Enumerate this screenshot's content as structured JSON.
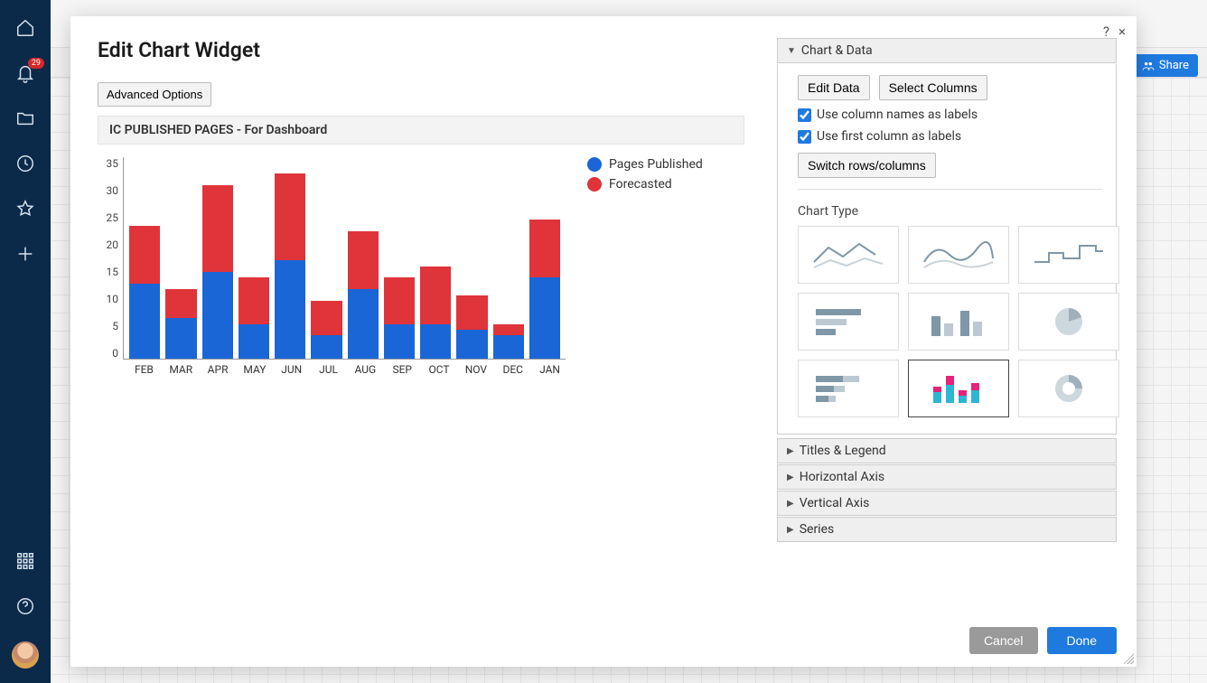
{
  "nav": {
    "notification_count": "29"
  },
  "header": {
    "share_label": "Share"
  },
  "modal": {
    "title": "Edit Chart Widget",
    "advanced_button": "Advanced Options",
    "chart_title": "IC PUBLISHED PAGES - For Dashboard",
    "help_tooltip": "?",
    "close_tooltip": "×"
  },
  "legend": {
    "series1": "Pages Published",
    "series2": "Forecasted"
  },
  "panel": {
    "section_chart_data": "Chart & Data",
    "edit_data": "Edit Data",
    "select_columns": "Select Columns",
    "chk_col_names": "Use column names as labels",
    "chk_first_col": "Use first column as labels",
    "switch_btn": "Switch rows/columns",
    "chart_type_label": "Chart Type",
    "section_titles": "Titles & Legend",
    "section_haxis": "Horizontal Axis",
    "section_vaxis": "Vertical Axis",
    "section_series": "Series",
    "cancel": "Cancel",
    "done": "Done"
  },
  "chart_data": {
    "type": "bar",
    "stacked": true,
    "title": "IC PUBLISHED PAGES - For Dashboard",
    "xlabel": "",
    "ylabel": "",
    "ylim": [
      0,
      35
    ],
    "yticks": [
      0,
      5,
      10,
      15,
      20,
      25,
      30,
      35
    ],
    "categories": [
      "FEB",
      "MAR",
      "APR",
      "MAY",
      "JUN",
      "JUL",
      "AUG",
      "SEP",
      "OCT",
      "NOV",
      "DEC",
      "JAN"
    ],
    "series": [
      {
        "name": "Pages Published",
        "color": "#1a66d6",
        "values": [
          13,
          7,
          15,
          6,
          17,
          4,
          12,
          6,
          6,
          5,
          4,
          14
        ]
      },
      {
        "name": "Forecasted",
        "color": "#df343a",
        "values": [
          10,
          5,
          15,
          8,
          15,
          6,
          10,
          8,
          10,
          6,
          2,
          10
        ]
      }
    ]
  }
}
